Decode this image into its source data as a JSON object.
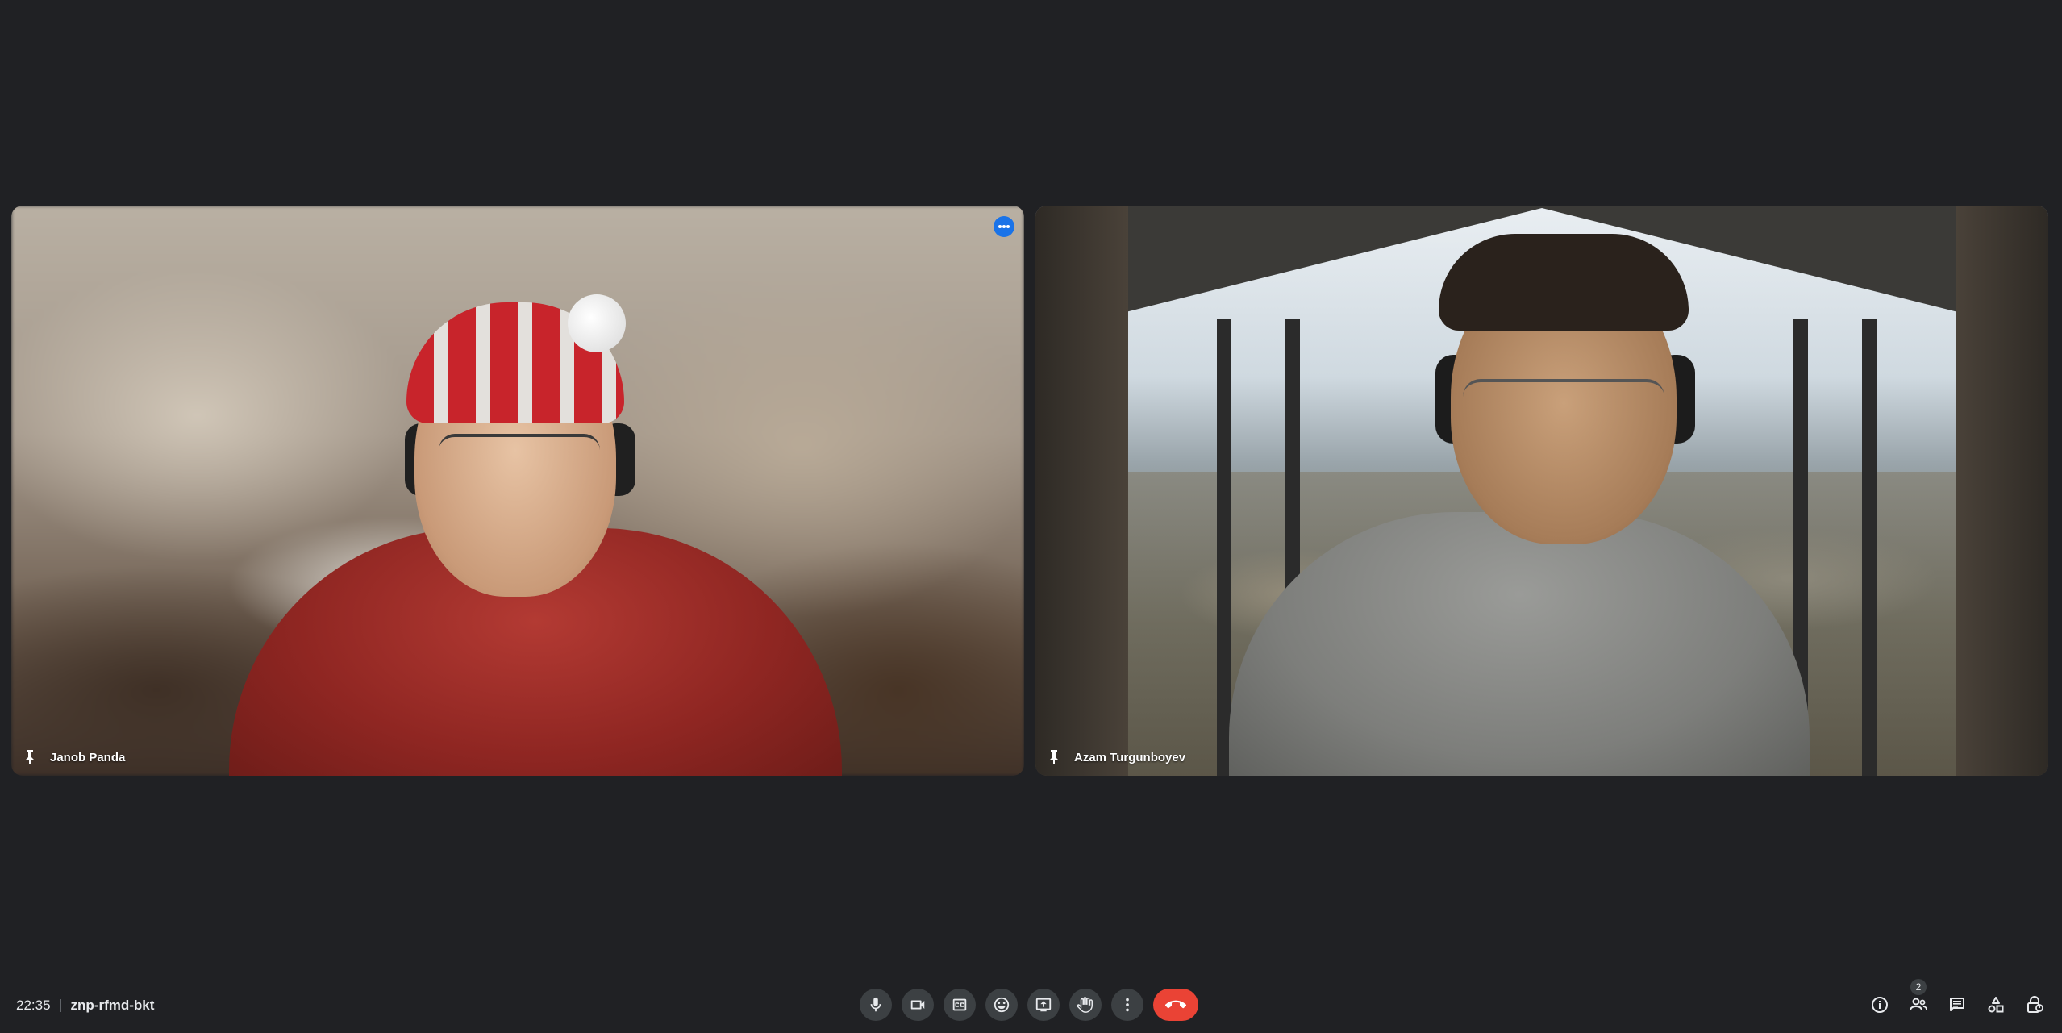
{
  "participants": [
    {
      "name": "Janob Panda",
      "pinned": true
    },
    {
      "name": "Azam Turgunboyev",
      "pinned": true
    }
  ],
  "meeting": {
    "time": "22:35",
    "code": "znp-rfmd-bkt"
  },
  "controls": {
    "items": [
      {
        "icon": "mic-icon"
      },
      {
        "icon": "camera-icon"
      },
      {
        "icon": "captions-icon"
      },
      {
        "icon": "emoji-icon"
      },
      {
        "icon": "present-screen-icon"
      },
      {
        "icon": "raise-hand-icon"
      },
      {
        "icon": "more-options-icon"
      },
      {
        "icon": "hangup-icon"
      }
    ],
    "hangup_color": "#ea4335",
    "button_color": "#3c4043"
  },
  "right_controls": {
    "people_count": "2"
  },
  "colors": {
    "background": "#202124",
    "accent": "#1a73e8"
  }
}
